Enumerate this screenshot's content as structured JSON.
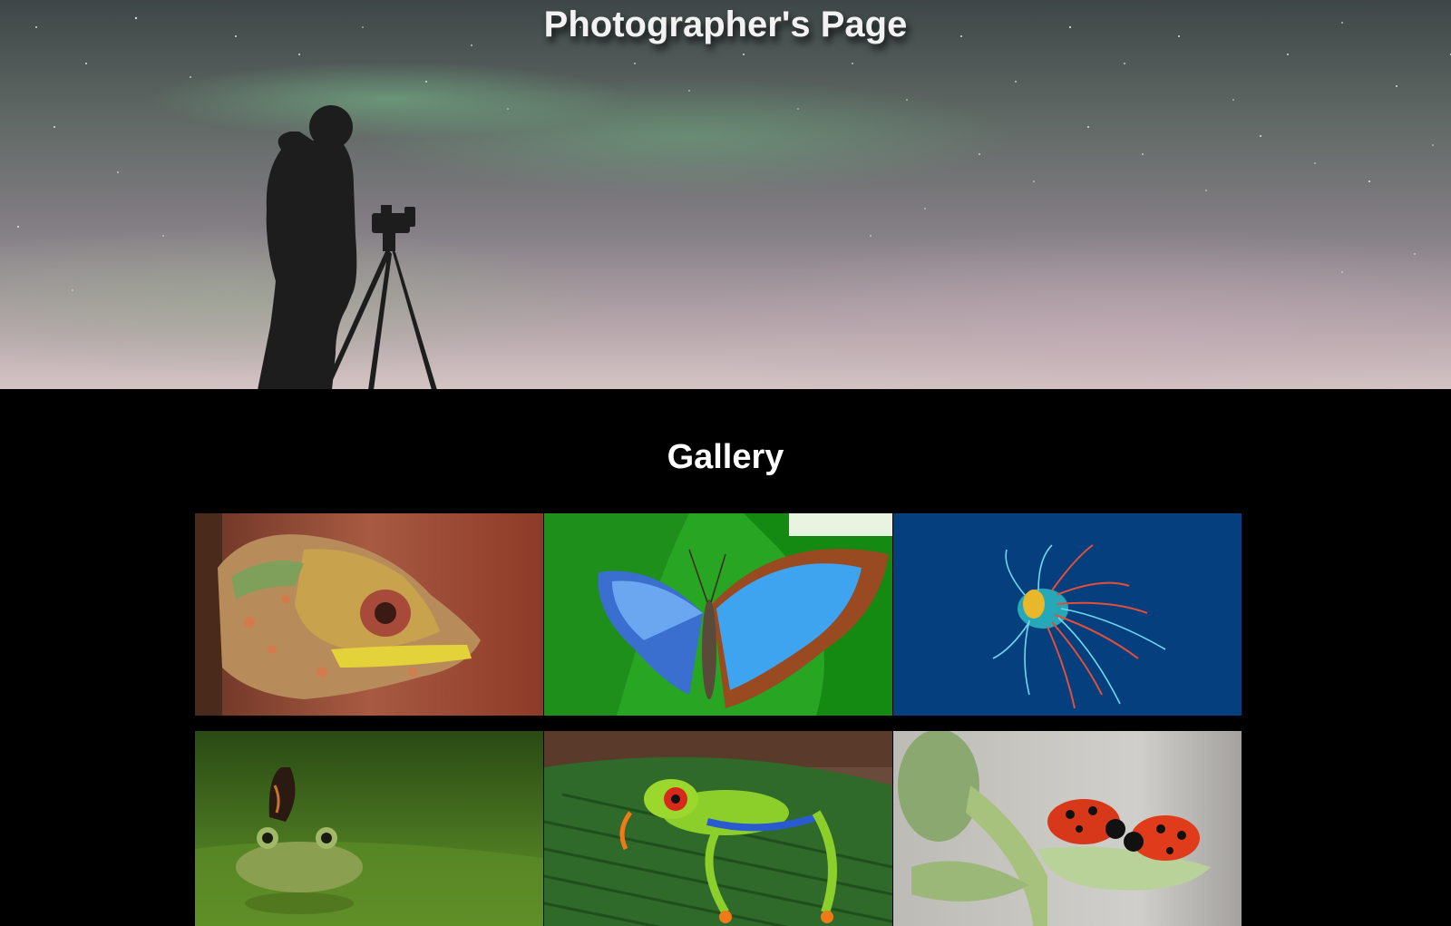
{
  "hero": {
    "title": "Photographer's Page"
  },
  "gallery": {
    "title": "Gallery",
    "items": [
      {
        "subject": "chameleon",
        "dominant_color": "#a0503a"
      },
      {
        "subject": "blue-morpho-butterfly",
        "dominant_color": "#2aa82a"
      },
      {
        "subject": "lionfish",
        "dominant_color": "#063f7e"
      },
      {
        "subject": "frog-with-butterfly",
        "dominant_color": "#3f6a1e"
      },
      {
        "subject": "red-eyed-tree-frog",
        "dominant_color": "#2f6a2a"
      },
      {
        "subject": "ladybugs",
        "dominant_color": "#c8c6c2"
      }
    ]
  },
  "colors": {
    "page_background": "#000000",
    "title_text": "#ffffff"
  }
}
